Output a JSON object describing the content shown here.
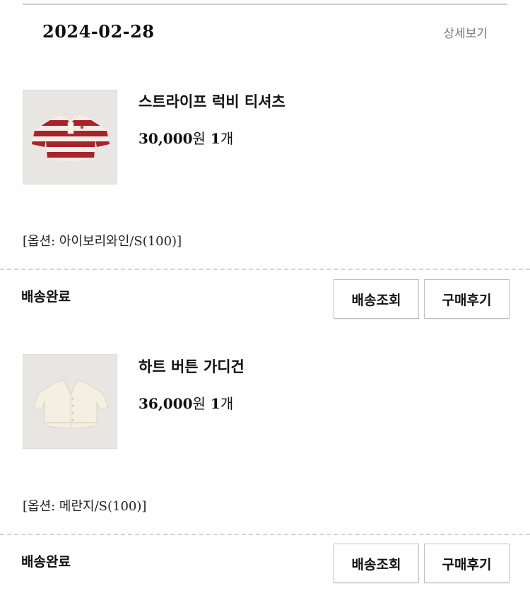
{
  "order": {
    "date": "2024-02-28",
    "detail_link": "상세보기"
  },
  "items": [
    {
      "name": "스트라이프 럭비 티셔츠",
      "price": "30,000",
      "currency": "원",
      "quantity": "1",
      "quantity_unit": "개",
      "option": "[옵션: 아이보리와인/S(100)]",
      "status": "배송완료",
      "track_button": "배송조회",
      "review_button": "구매후기",
      "thumb_icon": "striped-rugby-shirt-image"
    },
    {
      "name": "하트 버튼 가디건",
      "price": "36,000",
      "currency": "원",
      "quantity": "1",
      "quantity_unit": "개",
      "option": "[옵션: 메란지/S(100)]",
      "status": "배송완료",
      "track_button": "배송조회",
      "review_button": "구매후기",
      "thumb_icon": "cream-cardigan-image"
    }
  ],
  "colors": {
    "stripe_red": "#a8232b",
    "stripe_cream": "#f4efe6",
    "cardigan_cream": "#f3efe2",
    "thumb_bg": "#e8e6e3"
  }
}
